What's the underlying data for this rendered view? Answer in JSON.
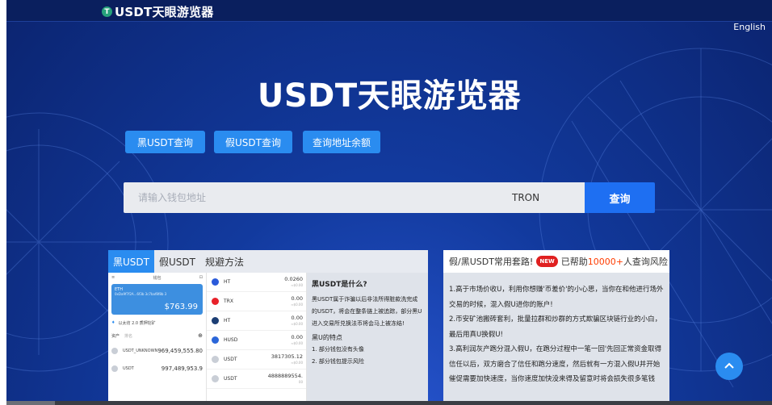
{
  "site": {
    "logo_icon": "T",
    "logo_text": "USDT天眼游览器",
    "lang_link": "English"
  },
  "hero": {
    "title": "USDT天眼游览器"
  },
  "query_buttons": [
    "黑USDT查询",
    "假USDT查询",
    "查询地址余额"
  ],
  "search": {
    "placeholder": "请输入钱包地址",
    "network": "TRON",
    "button": "查询"
  },
  "left_panel": {
    "tabs": [
      "黑USDT",
      "假USDT",
      "规避方法"
    ],
    "active_tab": 0,
    "wallet": {
      "menu_icon": "≡",
      "header_label": "钱包",
      "scan_icon": "⊡",
      "eth_label": "ETH",
      "eth_address": "0xDa9f7f2A...6f3b 3c7baf8f8b 3",
      "eth_balance": "$763.99",
      "staking_text": "以太坊 2.0 质押挖矿",
      "assets_label": "资产",
      "assets_sub": "排名",
      "add_icon": "⊕",
      "rows": [
        {
          "name": "USDT_UNKNOWN",
          "value": "969,459,555.80"
        },
        {
          "name": "USDT",
          "value": "997,489,953.9"
        }
      ]
    },
    "coins": [
      {
        "symbol": "HT",
        "amount": "0.0260",
        "sub": "≈$0.00",
        "color": "#2a5ada"
      },
      {
        "symbol": "TRX",
        "amount": "0.00",
        "sub": "≈$0.00",
        "color": "#e8212a"
      },
      {
        "symbol": "HT",
        "amount": "0.00",
        "sub": "≈$0.00",
        "color": "#1c3e74"
      },
      {
        "symbol": "HUSD",
        "amount": "0.00",
        "sub": "≈$0.00",
        "color": "#2b66d9"
      },
      {
        "symbol": "USDT",
        "amount": "3817305.12",
        "sub": "≈$0.00",
        "color": "#c9ced6"
      },
      {
        "symbol": "USDT",
        "amount": "4888889554.",
        "sub": "00",
        "color": "#c9ced6"
      }
    ],
    "explain": {
      "heading": "黑USDT是什么?",
      "body": "黑USDT属于诈骗以后非法所得脏款洗完成的USDT，将会在整条链上被追踪，部分黑U进入交易所兑换法币将会马上被冻结!",
      "sub_heading": "黑U的特点",
      "points": [
        "1. 部分钱包没有头像",
        "2. 部分钱包提示风险"
      ]
    }
  },
  "right_panel": {
    "title_prefix": "假/黑USDT常用套路!",
    "badge": "NEW",
    "helped_prefix": "已帮助",
    "helped_count": "10000+",
    "helped_suffix": "人查询风险",
    "paragraphs": [
      "1.高于市场价收U，利用你想赚'币差价'的小心思，当你在和他进行场外交易的时候，混入假U进你的账户!",
      "2.币安矿池搬砖套利，批量拉群和炒群的方式欺骗区块链行业的小白，最后用真U换假U!",
      "3.高利润灰产跑分混入假U，在跑分过程中一笔一回'先回正常资金取得信任以后，双方磨合了信任和跑分速度，然后就有一方混入假U并开始催促需要加快速度，当你速度加快没来得及留意时将会损失很多笔钱"
    ]
  },
  "fab": {
    "icon": "chevron-up-icon"
  },
  "colors": {
    "accent": "#2a8cf0",
    "search_btn": "#1e6ff2",
    "bg": "#123a9e",
    "highlight": "#ff3c00"
  }
}
